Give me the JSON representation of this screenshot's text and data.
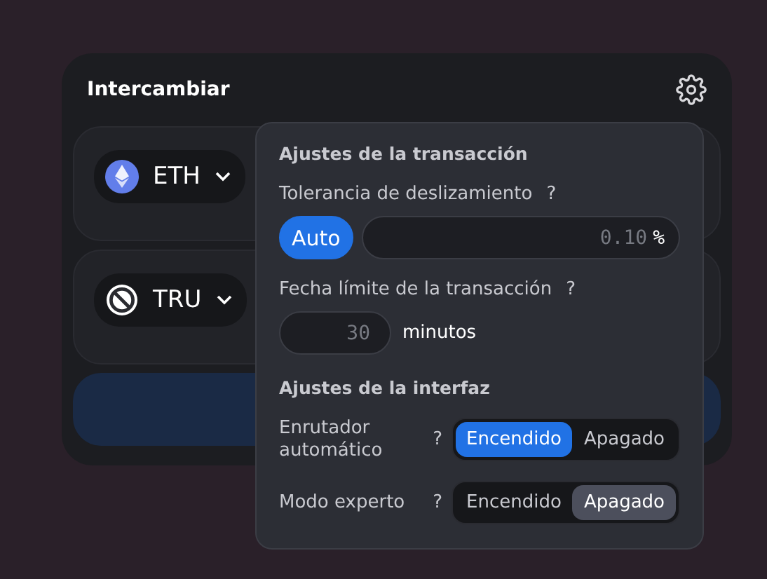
{
  "swap": {
    "title": "Intercambiar",
    "tokens": [
      {
        "symbol": "ETH",
        "kind": "eth"
      },
      {
        "symbol": "TRU",
        "kind": "blocked"
      }
    ]
  },
  "settings": {
    "transaction_title": "Ajustes de la transacción",
    "slippage": {
      "label": "Tolerancia de deslizamiento",
      "help": "?",
      "auto": {
        "label": "Auto",
        "selected": true
      },
      "placeholder": "0.10",
      "unit": "%"
    },
    "deadline": {
      "label": "Fecha límite de la transacción",
      "help": "?",
      "placeholder": "30",
      "unit": "minutos"
    },
    "interface_title": "Ajustes de la interfaz",
    "toggles": [
      {
        "label": "Enrutador automático",
        "help": "?",
        "options": [
          {
            "label": "Encendido",
            "selected": true
          },
          {
            "label": "Apagado",
            "selected": false
          }
        ]
      },
      {
        "label": "Modo experto",
        "help": "?",
        "options": [
          {
            "label": "Encendido",
            "selected": false
          },
          {
            "label": "Apagado",
            "selected": true
          }
        ]
      }
    ]
  }
}
